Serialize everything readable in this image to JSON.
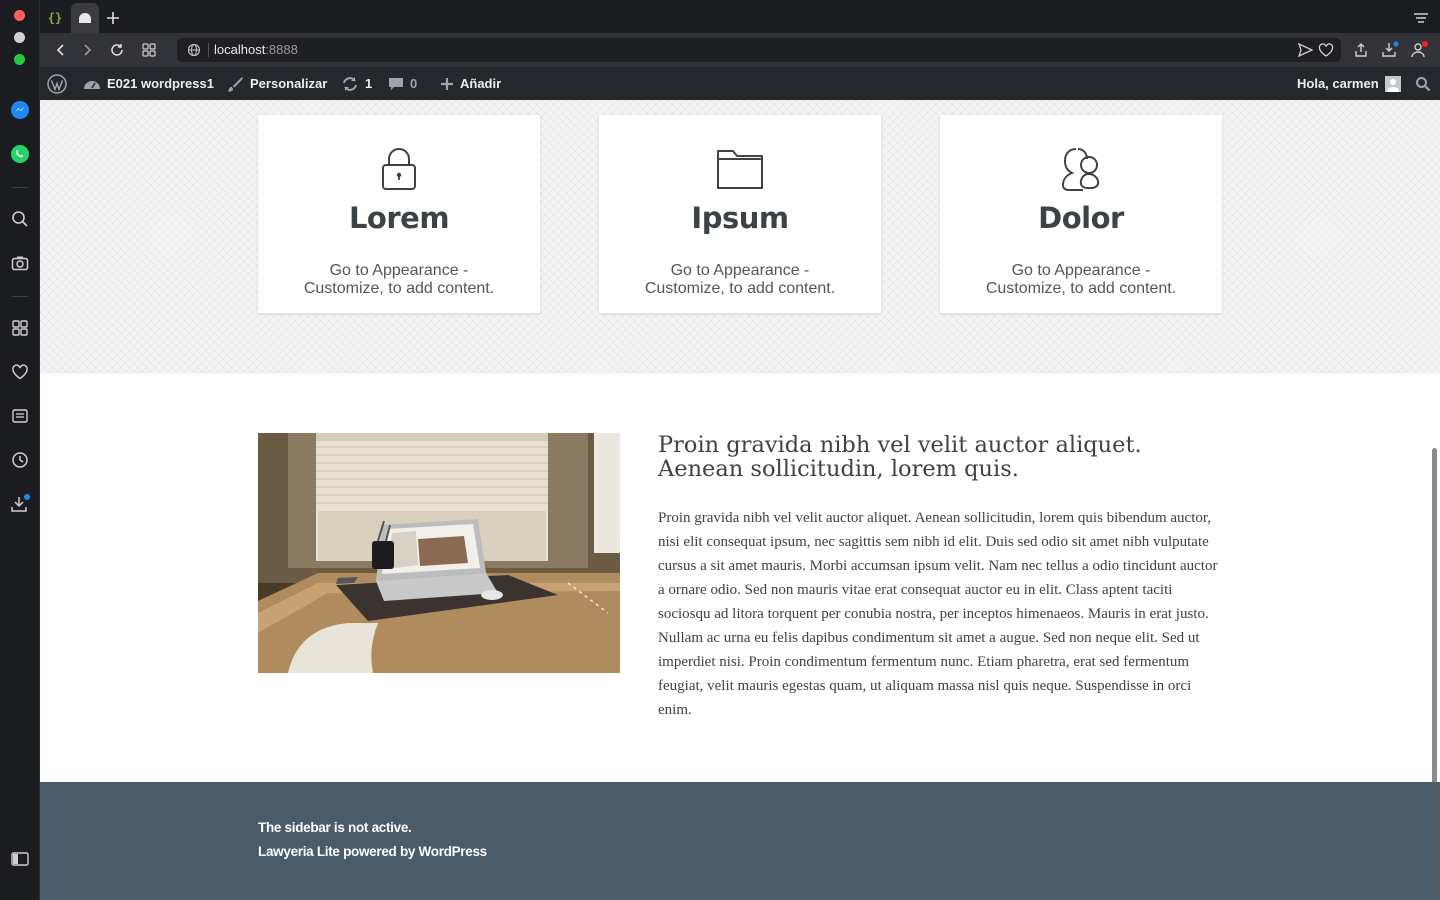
{
  "browser": {
    "url_host": "localhost",
    "url_port": ":8888",
    "brand_color": "#ff1b2d"
  },
  "adminbar": {
    "site_name": "E021 wordpress1",
    "customize": "Personalizar",
    "updates_count": "1",
    "comments_count": "0",
    "add_new": "Añadir",
    "greeting": "Hola, carmen"
  },
  "features": [
    {
      "icon": "lock-icon",
      "title": "Lorem",
      "text": "Go to Appearance - Customize, to add content."
    },
    {
      "icon": "folder-icon",
      "title": "Ipsum",
      "text": "Go to Appearance - Customize, to add content."
    },
    {
      "icon": "users-icon",
      "title": "Dolor",
      "text": "Go to Appearance - Customize, to add content."
    }
  ],
  "article": {
    "title": "Proin gravida nibh vel velit auctor aliquet. Aenean sollicitudin, lorem quis.",
    "body": "Proin gravida nibh vel velit auctor aliquet. Aenean sollicitudin, lorem quis bibendum auctor, nisi elit consequat ipsum, nec sagittis sem nibh id elit. Duis sed odio sit amet nibh vulputate cursus a sit amet mauris. Morbi accumsan ipsum velit. Nam nec tellus a odio tincidunt auctor a ornare odio. Sed non mauris vitae erat consequat auctor eu in elit. Class aptent taciti sociosqu ad litora torquent per conubia nostra, per inceptos himenaeos. Mauris in erat justo. Nullam ac urna eu felis dapibus condimentum sit amet a augue. Sed non neque elit. Sed ut imperdiet nisi. Proin condimentum fermentum nunc. Etiam pharetra, erat sed fermentum feugiat, velit mauris egestas quam, ut aliquam massa nisl quis neque. Suspendisse in orci enim."
  },
  "footer": {
    "sidebar_notice": "The sidebar is not active.",
    "credit": "Lawyeria Lite powered by WordPress"
  },
  "colors": {
    "footer_bg": "#4a5b6a",
    "adminbar_bg": "#23282d",
    "heading": "#3d4247"
  }
}
